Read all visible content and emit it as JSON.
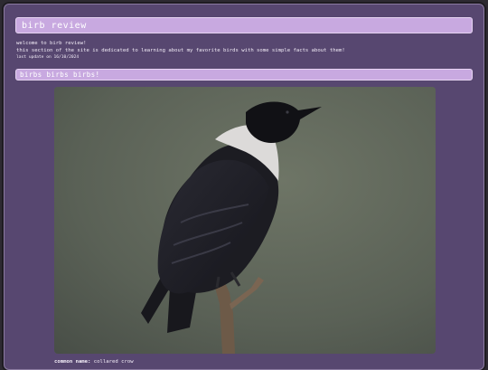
{
  "page": {
    "title": "birb review",
    "intro": [
      "welcome to birb review!",
      "this section of the site is dedicated to learning about my favorite birds with some simple facts about them!"
    ],
    "last_update": "last update on 16/10/2024"
  },
  "section": {
    "heading": "birbs birbs birbs!"
  },
  "bird": {
    "image": "collared-crow-photo",
    "common_name_label": "common name:",
    "common_name": "collared crow"
  },
  "colors": {
    "panel": "#574770",
    "accent": "#c8a9e0",
    "text": "#f2ecf7"
  }
}
